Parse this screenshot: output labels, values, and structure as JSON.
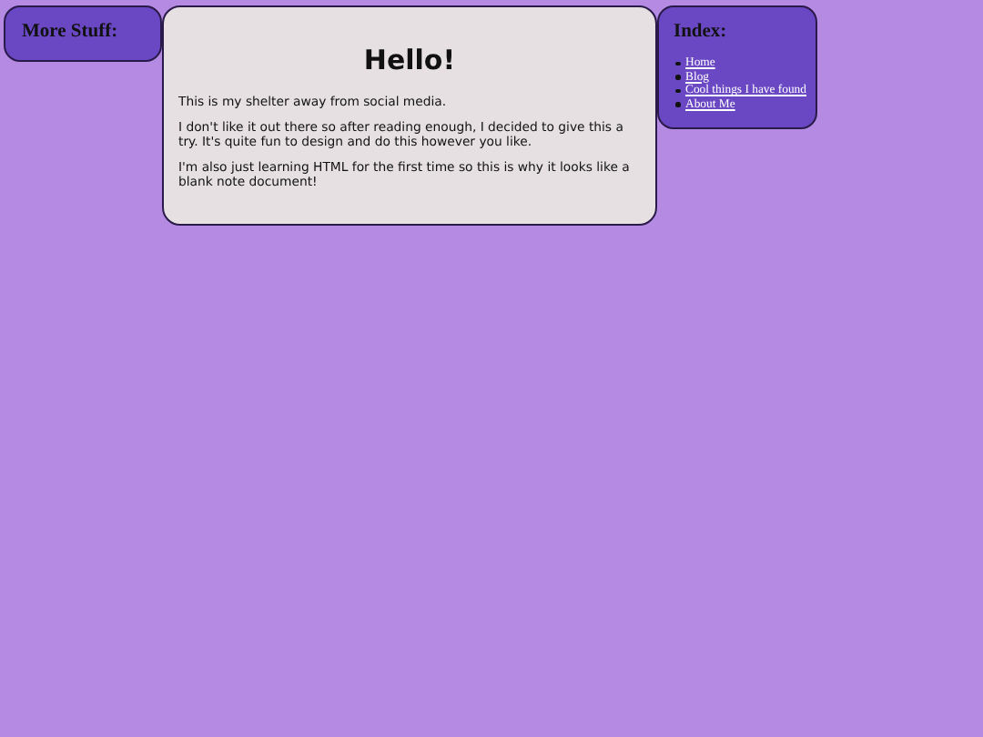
{
  "left_panel": {
    "title": "More Stuff:"
  },
  "main_card": {
    "title": "Hello!",
    "paragraphs": [
      "This is my shelter away from social media.",
      "I don't like it out there so after reading enough, I decided to give this a try. It's quite fun to design and do this however you like.",
      "I'm also just learning HTML for the first time so this is why it looks like a blank note document!"
    ]
  },
  "index_panel": {
    "title": "Index:",
    "links": [
      "Home",
      "Blog",
      "Cool things I have found",
      "About Me"
    ]
  }
}
